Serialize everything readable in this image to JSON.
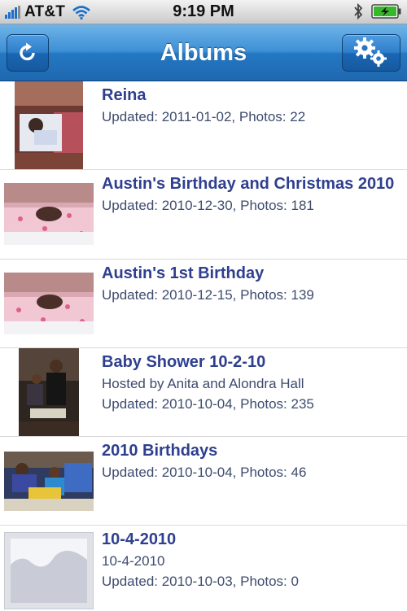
{
  "status_bar": {
    "carrier": "AT&T",
    "time": "9:19 PM"
  },
  "nav": {
    "title": "Albums",
    "left_button": "refresh-icon",
    "right_button": "gears-icon"
  },
  "albums": [
    {
      "title": "Reina",
      "subtitle": "",
      "updated": "Updated: 2011-01-02, Photos: 22"
    },
    {
      "title": "Austin's Birthday and Christmas 2010",
      "subtitle": "",
      "updated": "Updated: 2010-12-30, Photos: 181"
    },
    {
      "title": "Austin's 1st Birthday",
      "subtitle": "",
      "updated": "Updated: 2010-12-15, Photos: 139"
    },
    {
      "title": "Baby Shower 10-2-10",
      "subtitle": "Hosted by Anita and Alondra Hall",
      "updated": "Updated: 2010-10-04, Photos: 235"
    },
    {
      "title": "2010 Birthdays",
      "subtitle": "",
      "updated": "Updated: 2010-10-04, Photos: 46"
    },
    {
      "title": "10-4-2010",
      "subtitle": "10-4-2010",
      "updated": "Updated: 2010-10-03, Photos: 0"
    }
  ]
}
